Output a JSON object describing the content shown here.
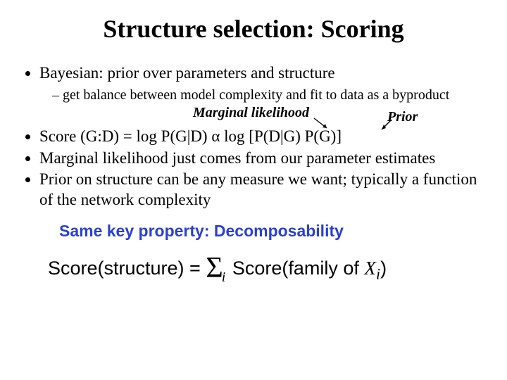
{
  "title": "Structure selection: Scoring",
  "bullets": {
    "bayesian": "Bayesian: prior over parameters and structure",
    "sub_balance": "get balance between model complexity and fit to data as a byproduct",
    "marginal_likelihood_label": "Marginal likelihood",
    "prior_label": "Prior",
    "score_formula": "Score (G:D) = log P(G|D) α log [P(D|G) P(G)]",
    "marginal_text": "Marginal likelihood just comes from our parameter estimates",
    "prior_text": "Prior on structure can be any measure we want; typically a function of the network complexity"
  },
  "decomposability": "Same key property: Decomposability",
  "score_equation": {
    "lhs": "Score(structure) = ",
    "sigma": "Σ",
    "sub": "i",
    "rhs1": " Score(family of ",
    "xi": "X",
    "xi_sub": "i",
    "rhs2": ")"
  }
}
